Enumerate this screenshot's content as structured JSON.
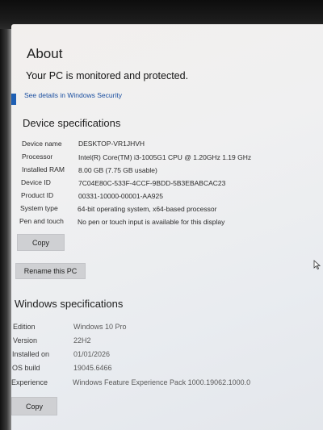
{
  "page": {
    "title": "About",
    "security_status": "Your PC is monitored and protected.",
    "security_link": "See details in Windows Security"
  },
  "device_specs": {
    "heading": "Device specifications",
    "rows": [
      {
        "label": "Device name",
        "value": "DESKTOP-VR1JHVH"
      },
      {
        "label": "Processor",
        "value": "Intel(R) Core(TM) i3-1005G1 CPU @ 1.20GHz   1.19 GHz"
      },
      {
        "label": "Installed RAM",
        "value": "8.00 GB (7.75 GB usable)"
      },
      {
        "label": "Device ID",
        "value": "7C04E80C-533F-4CCF-9BDD-5B3EBABCAC23"
      },
      {
        "label": "Product ID",
        "value": "00331-10000-00001-AA925"
      },
      {
        "label": "System type",
        "value": "64-bit operating system, x64-based processor"
      },
      {
        "label": "Pen and touch",
        "value": "No pen or touch input is available for this display"
      }
    ],
    "copy_label": "Copy",
    "rename_label": "Rename this PC"
  },
  "windows_specs": {
    "heading": "Windows specifications",
    "rows": [
      {
        "label": "Edition",
        "value": "Windows 10 Pro"
      },
      {
        "label": "Version",
        "value": "22H2"
      },
      {
        "label": "Installed on",
        "value": "01/01/2026"
      },
      {
        "label": "OS build",
        "value": "19045.6466"
      },
      {
        "label": "Experience",
        "value": "Windows Feature Experience Pack 1000.19062.1000.0"
      }
    ],
    "copy_label": "Copy"
  },
  "colors": {
    "accent_link": "#1a4fa0",
    "button_bg": "#cfd0d3"
  }
}
